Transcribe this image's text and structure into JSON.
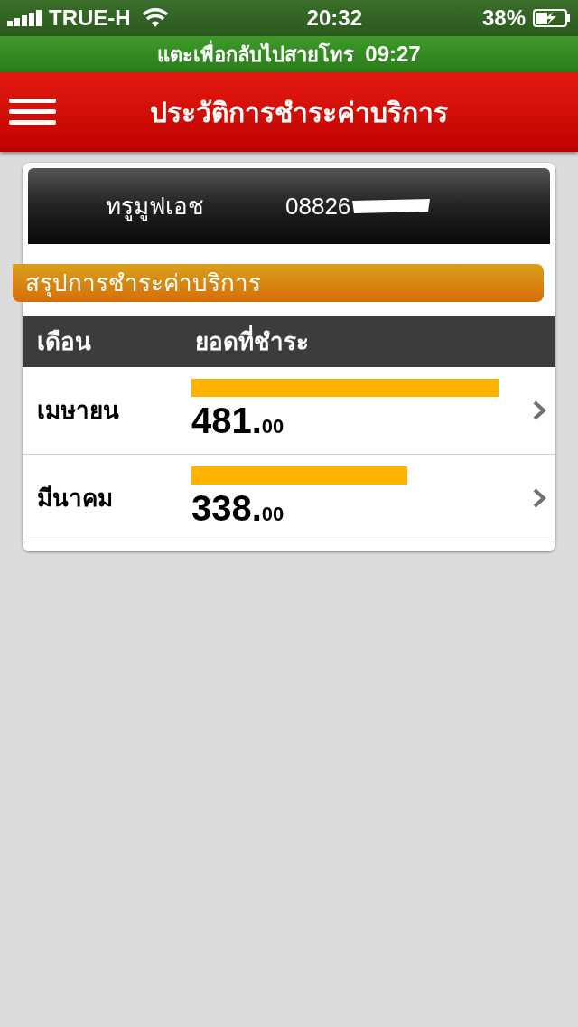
{
  "status_bar": {
    "carrier": "TRUE-H",
    "time": "20:32",
    "battery": "38%"
  },
  "call_banner": {
    "text": "แตะเพื่อกลับไปสายโทร",
    "duration": "09:27"
  },
  "header": {
    "title": "ประวัติการชำระค่าบริการ"
  },
  "account": {
    "name": "ทรูมูฟเอช",
    "number": "08826"
  },
  "section_title": "สรุปการชำระค่าบริการ",
  "table": {
    "columns": [
      "เดือน",
      "ยอดที่ชำระ"
    ],
    "rows": [
      {
        "month": "เมษายน",
        "amount": "481.",
        "fraction": "00"
      },
      {
        "month": "มีนาคม",
        "amount": "338.",
        "fraction": "00"
      }
    ]
  }
}
